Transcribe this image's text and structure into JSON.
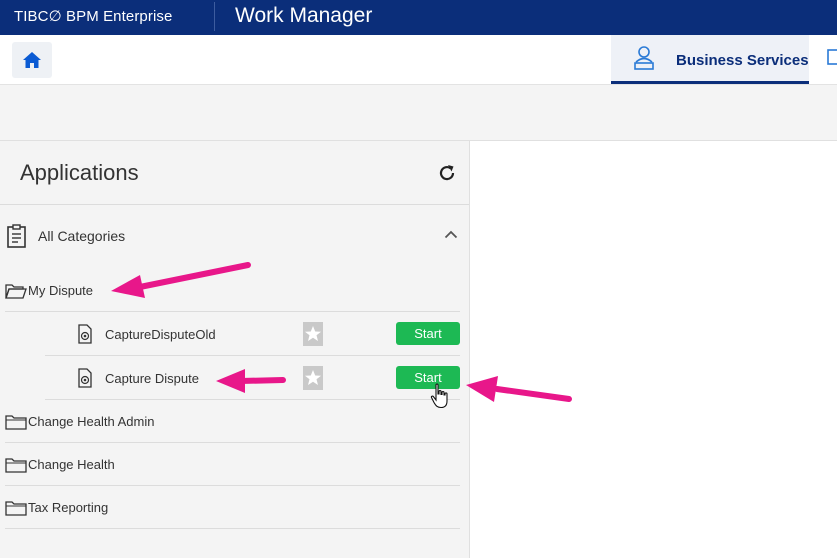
{
  "topbar": {
    "brand": "TIBC∅ BPM Enterprise",
    "app_title": "Work Manager"
  },
  "nav": {
    "home_icon": "home-icon",
    "tabs": [
      {
        "label": "Business Services",
        "icon": "person-desk-icon",
        "active": true
      },
      {
        "label": "",
        "icon": "calendar-icon",
        "active": false
      }
    ]
  },
  "panel": {
    "title": "Applications",
    "refresh_icon": "refresh-icon",
    "all_categories": "All Categories",
    "folders": [
      {
        "label": "My Dispute",
        "expanded": true,
        "processes": [
          {
            "label": "CaptureDisputeOld",
            "start_label": "Start"
          },
          {
            "label": "Capture Dispute",
            "start_label": "Start"
          }
        ]
      },
      {
        "label": "Change Health Admin",
        "expanded": false
      },
      {
        "label": "Change Health",
        "expanded": false
      },
      {
        "label": "Tax Reporting",
        "expanded": false
      }
    ]
  },
  "colors": {
    "topbar": "#0b2e7a",
    "start_button": "#1db954",
    "annotation_arrow": "#e8178a",
    "panel_bg": "#f4f4f4"
  }
}
